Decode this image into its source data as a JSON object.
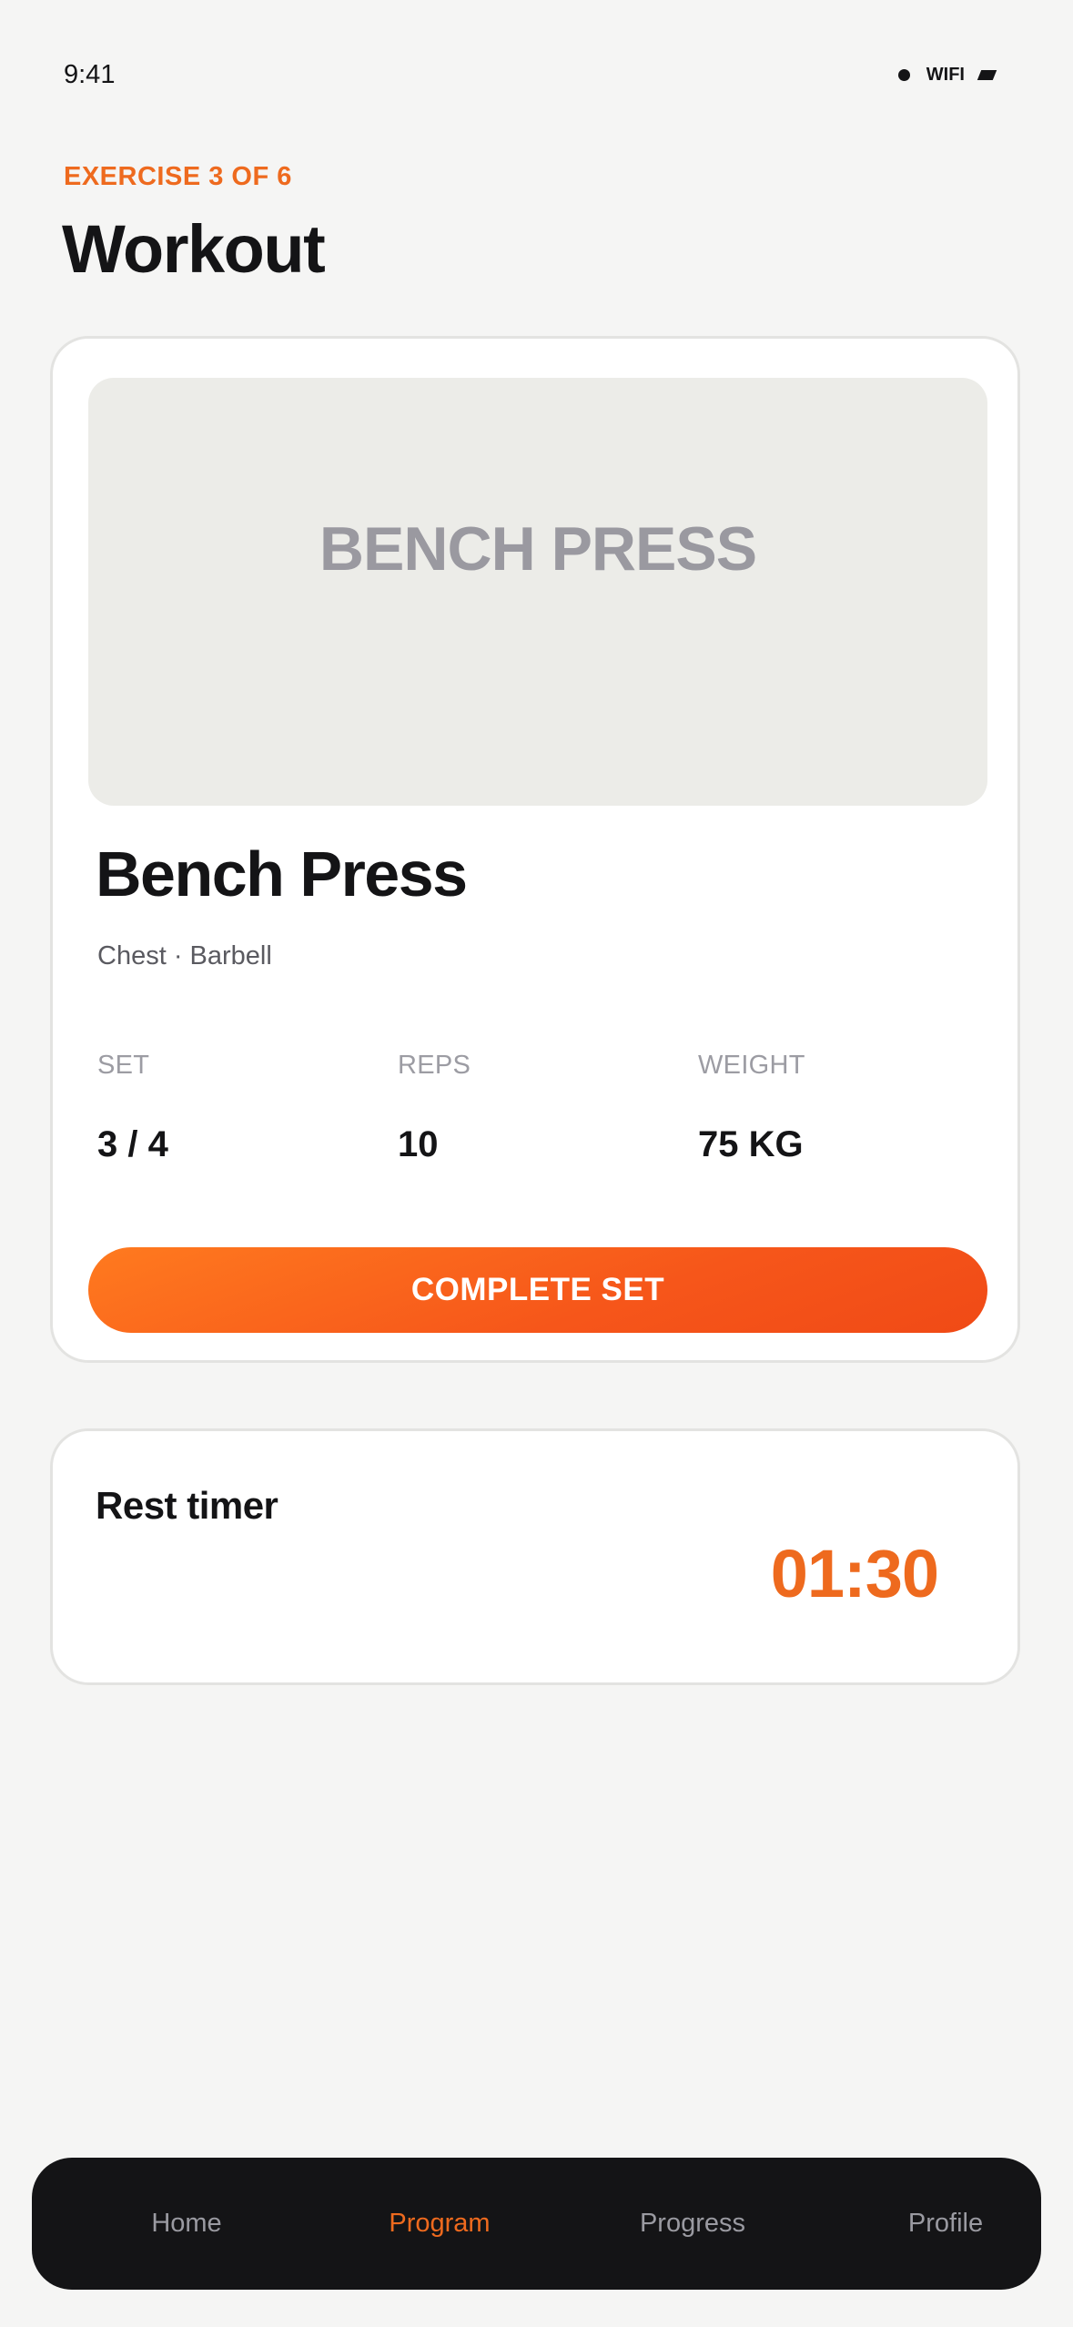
{
  "status_bar": {
    "time": "9:41",
    "network": "WIFI"
  },
  "header": {
    "eyebrow": "EXERCISE 3 OF 6",
    "title": "Workout"
  },
  "exercise": {
    "media_label": "BENCH PRESS",
    "name": "Bench Press",
    "meta": "Chest · Barbell",
    "stats": [
      {
        "label": "SET",
        "value": "3 / 4"
      },
      {
        "label": "REPS",
        "value": "10"
      },
      {
        "label": "WEIGHT",
        "value": "75 KG"
      }
    ],
    "complete_button_label": "COMPLETE SET"
  },
  "rest_timer": {
    "title": "Rest timer",
    "value": "01:30"
  },
  "tab_bar": {
    "tabs": [
      {
        "label": "Home",
        "active": false
      },
      {
        "label": "Program",
        "active": true
      },
      {
        "label": "Progress",
        "active": false
      },
      {
        "label": "Profile",
        "active": false
      }
    ]
  },
  "colors": {
    "accent": "#ee6a1e",
    "button_gradient_start": "#ff7a1f",
    "button_gradient_end": "#f04a16",
    "background": "#f5f5f4",
    "tab_bar": "#141416"
  },
  "icons": {
    "status_dot": "signal-dot-icon",
    "battery": "battery-icon"
  }
}
